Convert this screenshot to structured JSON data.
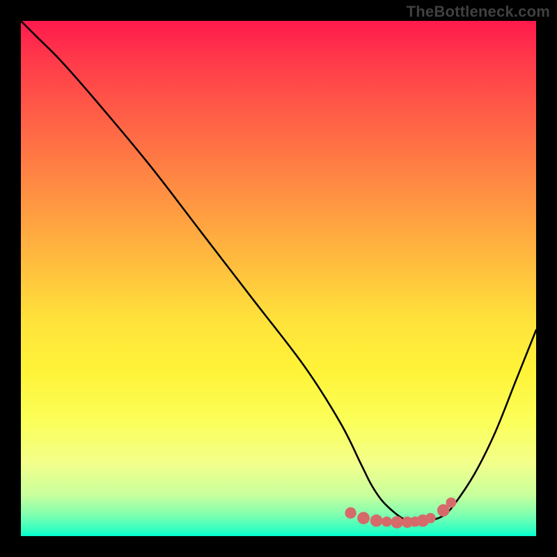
{
  "watermark": "TheBottleneck.com",
  "chart_data": {
    "type": "line",
    "title": "",
    "xlabel": "",
    "ylabel": "",
    "xlim": [
      0,
      100
    ],
    "ylim": [
      0,
      100
    ],
    "series": [
      {
        "name": "bottleneck-curve",
        "x": [
          0,
          3,
          8,
          15,
          25,
          35,
          45,
          55,
          62,
          66,
          68,
          70,
          72,
          74,
          76,
          78,
          80,
          82,
          84,
          88,
          92,
          96,
          100
        ],
        "y": [
          100,
          97,
          92,
          84,
          72,
          59,
          46,
          33,
          22,
          14,
          10,
          7,
          5,
          3.5,
          3,
          3,
          3.2,
          4,
          6,
          12,
          20,
          30,
          40
        ]
      }
    ],
    "markers": {
      "name": "optimal-range-dots",
      "color": "#d66a6a",
      "points": [
        {
          "x": 64,
          "y": 4.5,
          "r": 1.1
        },
        {
          "x": 66.5,
          "y": 3.5,
          "r": 1.2
        },
        {
          "x": 69,
          "y": 3.0,
          "r": 1.2
        },
        {
          "x": 71,
          "y": 2.8,
          "r": 1.0
        },
        {
          "x": 73,
          "y": 2.7,
          "r": 1.2
        },
        {
          "x": 75,
          "y": 2.7,
          "r": 1.1
        },
        {
          "x": 76.5,
          "y": 2.8,
          "r": 1.0
        },
        {
          "x": 78,
          "y": 3.0,
          "r": 1.2
        },
        {
          "x": 79.5,
          "y": 3.5,
          "r": 1.0
        },
        {
          "x": 82,
          "y": 5.0,
          "r": 1.2
        },
        {
          "x": 83.5,
          "y": 6.5,
          "r": 1.0
        }
      ]
    },
    "gradient_stops": [
      {
        "pos": 0,
        "color": "#ff1a4d"
      },
      {
        "pos": 50,
        "color": "#ffd83b"
      },
      {
        "pos": 80,
        "color": "#f8ff6a"
      },
      {
        "pos": 100,
        "color": "#00ffd0"
      }
    ]
  }
}
